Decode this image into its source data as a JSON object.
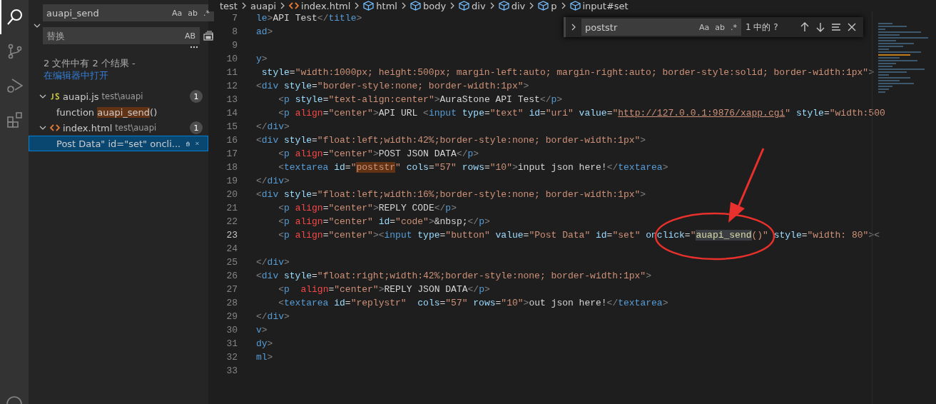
{
  "activity_bar": {
    "items": [
      {
        "kind": "search",
        "selected": true
      },
      {
        "kind": "source-control",
        "selected": false
      },
      {
        "kind": "run-debug",
        "selected": false
      },
      {
        "kind": "extensions",
        "selected": false
      },
      {
        "kind": "account",
        "selected": false
      }
    ]
  },
  "sidebar": {
    "search": {
      "value": "auapi_send",
      "options": [
        "Aa",
        "ab",
        ".*"
      ]
    },
    "replace": {
      "placeholder": "替换",
      "options": [
        "AB"
      ]
    },
    "summary": "2 文件中有 2 个结果 - ",
    "summary_link": "在编辑器中打开",
    "results": [
      {
        "file": "auapi.js",
        "kind": "js",
        "path": "test\\auapi",
        "count": "1",
        "expanded": true,
        "matches": [
          {
            "before": "function ",
            "match": "auapi_send",
            "after": "()",
            "selected": false
          }
        ]
      },
      {
        "file": "index.html",
        "kind": "html",
        "path": "test\\auapi",
        "count": "1",
        "expanded": true,
        "matches": [
          {
            "before": "Post Data\" id=\"set\" oncli...",
            "selected": true
          }
        ]
      }
    ]
  },
  "breadcrumbs": [
    {
      "label": "test",
      "kind": "folder"
    },
    {
      "label": "auapi",
      "kind": "folder"
    },
    {
      "label": "index.html",
      "kind": "file"
    },
    {
      "label": "html",
      "kind": "element"
    },
    {
      "label": "body",
      "kind": "element"
    },
    {
      "label": "div",
      "kind": "element"
    },
    {
      "label": "div",
      "kind": "element"
    },
    {
      "label": "p",
      "kind": "element"
    },
    {
      "label": "input#set",
      "kind": "element"
    }
  ],
  "find_widget": {
    "value": "poststr",
    "options": [
      "Aa",
      "ab",
      ".*"
    ],
    "result": "1 中的 ?"
  },
  "editor": {
    "lines": [
      {
        "number": "7",
        "current": false,
        "tokens": [
          {
            "kind": "tag",
            "text": "le"
          },
          {
            "kind": "punct",
            "text": ">"
          },
          {
            "kind": "text",
            "text": "API Test"
          },
          {
            "kind": "punct",
            "text": "</"
          },
          {
            "kind": "tag",
            "text": "title"
          },
          {
            "kind": "punct",
            "text": ">"
          }
        ]
      },
      {
        "number": "8",
        "current": false,
        "tokens": [
          {
            "kind": "tag",
            "text": "ad"
          },
          {
            "kind": "punct",
            "text": ">"
          }
        ]
      },
      {
        "number": "9",
        "current": false
      },
      {
        "number": "10",
        "current": false,
        "tokens": [
          {
            "kind": "tag",
            "text": "y"
          },
          {
            "kind": "punct",
            "text": ">"
          }
        ]
      },
      {
        "number": "11",
        "current": false,
        "tokens": [
          {
            "kind": "attr",
            "text": " style"
          },
          {
            "kind": "text",
            "text": "="
          },
          {
            "kind": "string",
            "text": "\"width:1000px; height:500px; margin-left:auto; margin-right:auto; border-style:solid; border-width:1px\""
          },
          {
            "kind": "punct",
            "text": ">"
          }
        ]
      },
      {
        "number": "12",
        "current": false,
        "tokens": [
          {
            "kind": "punct",
            "text": "<"
          },
          {
            "kind": "tag",
            "text": "div"
          },
          {
            "kind": "attr",
            "text": " style"
          },
          {
            "kind": "text",
            "text": "="
          },
          {
            "kind": "string",
            "text": "\"border-style:none; border-width:1px\""
          },
          {
            "kind": "punct",
            "text": ">"
          }
        ]
      },
      {
        "number": "13",
        "current": false,
        "tokens": [
          {
            "kind": "punct",
            "text": "    <"
          },
          {
            "kind": "tag",
            "text": "p"
          },
          {
            "kind": "attr",
            "text": " style"
          },
          {
            "kind": "text",
            "text": "="
          },
          {
            "kind": "string",
            "text": "\"text-align:center\""
          },
          {
            "kind": "punct",
            "text": ">"
          },
          {
            "kind": "text",
            "text": "AuraStone API Test"
          },
          {
            "kind": "punct",
            "text": "</"
          },
          {
            "kind": "tag",
            "text": "p"
          },
          {
            "kind": "punct",
            "text": ">"
          }
        ]
      },
      {
        "number": "14",
        "current": false,
        "tokens": [
          {
            "kind": "punct",
            "text": "    <"
          },
          {
            "kind": "tag",
            "text": "p"
          },
          {
            "kind": "deprecated",
            "text": " align"
          },
          {
            "kind": "text",
            "text": "="
          },
          {
            "kind": "string",
            "text": "\"center\""
          },
          {
            "kind": "punct",
            "text": ">"
          },
          {
            "kind": "text",
            "text": "API URL "
          },
          {
            "kind": "punct",
            "text": "<"
          },
          {
            "kind": "tag",
            "text": "input"
          },
          {
            "kind": "attr",
            "text": " type"
          },
          {
            "kind": "text",
            "text": "="
          },
          {
            "kind": "string",
            "text": "\"text\""
          },
          {
            "kind": "attr",
            "text": " id"
          },
          {
            "kind": "text",
            "text": "="
          },
          {
            "kind": "string",
            "text": "\"uri\""
          },
          {
            "kind": "attr",
            "text": " value"
          },
          {
            "kind": "text",
            "text": "="
          },
          {
            "kind": "string",
            "text": "\""
          },
          {
            "kind": "url",
            "text": "http://127.0.0.1:9876/xapp.cgi"
          },
          {
            "kind": "string",
            "text": "\""
          },
          {
            "kind": "attr",
            "text": " style"
          },
          {
            "kind": "text",
            "text": "="
          },
          {
            "kind": "string",
            "text": "\"width:500"
          }
        ]
      },
      {
        "number": "15",
        "current": false,
        "tokens": [
          {
            "kind": "punct",
            "text": "</"
          },
          {
            "kind": "tag",
            "text": "div"
          },
          {
            "kind": "punct",
            "text": ">"
          }
        ]
      },
      {
        "number": "16",
        "current": false,
        "tokens": [
          {
            "kind": "punct",
            "text": "<"
          },
          {
            "kind": "tag",
            "text": "div"
          },
          {
            "kind": "attr",
            "text": " style"
          },
          {
            "kind": "text",
            "text": "="
          },
          {
            "kind": "string",
            "text": "\"float:left;width:42%;border-style:none; border-width:1px\""
          },
          {
            "kind": "punct",
            "text": ">"
          }
        ]
      },
      {
        "number": "17",
        "current": false,
        "tokens": [
          {
            "kind": "punct",
            "text": "    <"
          },
          {
            "kind": "tag",
            "text": "p"
          },
          {
            "kind": "deprecated",
            "text": " align"
          },
          {
            "kind": "text",
            "text": "="
          },
          {
            "kind": "string",
            "text": "\"center\""
          },
          {
            "kind": "punct",
            "text": ">"
          },
          {
            "kind": "text",
            "text": "POST JSON DATA"
          },
          {
            "kind": "punct",
            "text": "</"
          },
          {
            "kind": "tag",
            "text": "p"
          },
          {
            "kind": "punct",
            "text": ">"
          }
        ]
      },
      {
        "number": "18",
        "current": false,
        "tokens": [
          {
            "kind": "punct",
            "text": "    <"
          },
          {
            "kind": "tag",
            "text": "textarea"
          },
          {
            "kind": "attr",
            "text": " id"
          },
          {
            "kind": "text",
            "text": "="
          },
          {
            "kind": "string",
            "text": "\""
          },
          {
            "kind": "find-match",
            "text": "poststr"
          },
          {
            "kind": "string",
            "text": "\""
          },
          {
            "kind": "attr",
            "text": " cols"
          },
          {
            "kind": "text",
            "text": "="
          },
          {
            "kind": "string",
            "text": "\"57\""
          },
          {
            "kind": "attr",
            "text": " rows"
          },
          {
            "kind": "text",
            "text": "="
          },
          {
            "kind": "string",
            "text": "\"10\""
          },
          {
            "kind": "punct",
            "text": ">"
          },
          {
            "kind": "text",
            "text": "input json here!"
          },
          {
            "kind": "punct",
            "text": "</"
          },
          {
            "kind": "tag",
            "text": "textarea"
          },
          {
            "kind": "punct",
            "text": ">"
          }
        ]
      },
      {
        "number": "19",
        "current": false,
        "tokens": [
          {
            "kind": "punct",
            "text": "</"
          },
          {
            "kind": "tag",
            "text": "div"
          },
          {
            "kind": "punct",
            "text": ">"
          }
        ]
      },
      {
        "number": "20",
        "current": false,
        "tokens": [
          {
            "kind": "punct",
            "text": "<"
          },
          {
            "kind": "tag",
            "text": "div"
          },
          {
            "kind": "attr",
            "text": " style"
          },
          {
            "kind": "text",
            "text": "="
          },
          {
            "kind": "string",
            "text": "\"float:left;width:16%;border-style:none; border-width:1px\""
          },
          {
            "kind": "punct",
            "text": ">"
          }
        ]
      },
      {
        "number": "21",
        "current": false,
        "tokens": [
          {
            "kind": "punct",
            "text": "    <"
          },
          {
            "kind": "tag",
            "text": "p"
          },
          {
            "kind": "deprecated",
            "text": " align"
          },
          {
            "kind": "text",
            "text": "="
          },
          {
            "kind": "string",
            "text": "\"center\""
          },
          {
            "kind": "punct",
            "text": ">"
          },
          {
            "kind": "text",
            "text": "REPLY CODE"
          },
          {
            "kind": "punct",
            "text": "</"
          },
          {
            "kind": "tag",
            "text": "p"
          },
          {
            "kind": "punct",
            "text": ">"
          }
        ]
      },
      {
        "number": "22",
        "current": false,
        "tokens": [
          {
            "kind": "punct",
            "text": "    <"
          },
          {
            "kind": "tag",
            "text": "p"
          },
          {
            "kind": "deprecated",
            "text": " align"
          },
          {
            "kind": "text",
            "text": "="
          },
          {
            "kind": "string",
            "text": "\"center\""
          },
          {
            "kind": "attr",
            "text": " id"
          },
          {
            "kind": "text",
            "text": "="
          },
          {
            "kind": "string",
            "text": "\"code\""
          },
          {
            "kind": "punct",
            "text": ">"
          },
          {
            "kind": "text",
            "text": "&nbsp;"
          },
          {
            "kind": "punct",
            "text": "</"
          },
          {
            "kind": "tag",
            "text": "p"
          },
          {
            "kind": "punct",
            "text": ">"
          }
        ]
      },
      {
        "number": "23",
        "current": true,
        "tokens": [
          {
            "kind": "punct",
            "text": "    <"
          },
          {
            "kind": "tag",
            "text": "p"
          },
          {
            "kind": "deprecated",
            "text": " align"
          },
          {
            "kind": "text",
            "text": "="
          },
          {
            "kind": "string",
            "text": "\"center\""
          },
          {
            "kind": "punct",
            "text": "><"
          },
          {
            "kind": "tag",
            "text": "input"
          },
          {
            "kind": "attr",
            "text": " type"
          },
          {
            "kind": "text",
            "text": "="
          },
          {
            "kind": "string",
            "text": "\"button\""
          },
          {
            "kind": "attr",
            "text": " value"
          },
          {
            "kind": "text",
            "text": "="
          },
          {
            "kind": "string",
            "text": "\"Post Data\""
          },
          {
            "kind": "attr",
            "text": " id"
          },
          {
            "kind": "text",
            "text": "="
          },
          {
            "kind": "string",
            "text": "\"set\""
          },
          {
            "kind": "attr",
            "text": " onclick"
          },
          {
            "kind": "text",
            "text": "="
          },
          {
            "kind": "string",
            "text": "\""
          },
          {
            "kind": "selection",
            "text": "auapi_send"
          },
          {
            "kind": "string",
            "text": "()\""
          },
          {
            "kind": "attr",
            "text": " style"
          },
          {
            "kind": "text",
            "text": "="
          },
          {
            "kind": "string",
            "text": "\"width: 80\""
          },
          {
            "kind": "punct",
            "text": "><"
          }
        ]
      },
      {
        "number": "24",
        "current": false
      },
      {
        "number": "25",
        "current": false,
        "tokens": [
          {
            "kind": "punct",
            "text": "</"
          },
          {
            "kind": "tag",
            "text": "div"
          },
          {
            "kind": "punct",
            "text": ">"
          }
        ]
      },
      {
        "number": "26",
        "current": false,
        "tokens": [
          {
            "kind": "punct",
            "text": "<"
          },
          {
            "kind": "tag",
            "text": "div"
          },
          {
            "kind": "attr",
            "text": " style"
          },
          {
            "kind": "text",
            "text": "="
          },
          {
            "kind": "string",
            "text": "\"float:right;width:42%;border-style:none; border-width:1px\""
          },
          {
            "kind": "punct",
            "text": ">"
          }
        ]
      },
      {
        "number": "27",
        "current": false,
        "tokens": [
          {
            "kind": "punct",
            "text": "    <"
          },
          {
            "kind": "tag",
            "text": "p"
          },
          {
            "kind": "deprecated",
            "text": "  align"
          },
          {
            "kind": "text",
            "text": "="
          },
          {
            "kind": "string",
            "text": "\"center\""
          },
          {
            "kind": "punct",
            "text": ">"
          },
          {
            "kind": "text",
            "text": "REPLY JSON DATA"
          },
          {
            "kind": "punct",
            "text": "</"
          },
          {
            "kind": "tag",
            "text": "p"
          },
          {
            "kind": "punct",
            "text": ">"
          }
        ]
      },
      {
        "number": "28",
        "current": false,
        "tokens": [
          {
            "kind": "punct",
            "text": "    <"
          },
          {
            "kind": "tag",
            "text": "textarea"
          },
          {
            "kind": "attr",
            "text": " id"
          },
          {
            "kind": "text",
            "text": "="
          },
          {
            "kind": "string",
            "text": "\"replystr\""
          },
          {
            "kind": "attr",
            "text": "  cols"
          },
          {
            "kind": "text",
            "text": "="
          },
          {
            "kind": "string",
            "text": "\"57\""
          },
          {
            "kind": "attr",
            "text": " rows"
          },
          {
            "kind": "text",
            "text": "="
          },
          {
            "kind": "string",
            "text": "\"10\""
          },
          {
            "kind": "punct",
            "text": ">"
          },
          {
            "kind": "text",
            "text": "out json here!"
          },
          {
            "kind": "punct",
            "text": "</"
          },
          {
            "kind": "tag",
            "text": "textarea"
          },
          {
            "kind": "punct",
            "text": ">"
          }
        ]
      },
      {
        "number": "29",
        "current": false,
        "tokens": [
          {
            "kind": "punct",
            "text": "</"
          },
          {
            "kind": "tag",
            "text": "div"
          },
          {
            "kind": "punct",
            "text": ">"
          }
        ]
      },
      {
        "number": "30",
        "current": false,
        "tokens": [
          {
            "kind": "tag",
            "text": "v"
          },
          {
            "kind": "punct",
            "text": ">"
          }
        ]
      },
      {
        "number": "31",
        "current": false,
        "tokens": [
          {
            "kind": "tag",
            "text": "dy"
          },
          {
            "kind": "punct",
            "text": ">"
          }
        ]
      },
      {
        "number": "32",
        "current": false,
        "tokens": [
          {
            "kind": "tag",
            "text": "ml"
          },
          {
            "kind": "punct",
            "text": ">"
          }
        ]
      },
      {
        "number": "33",
        "current": false
      }
    ]
  }
}
